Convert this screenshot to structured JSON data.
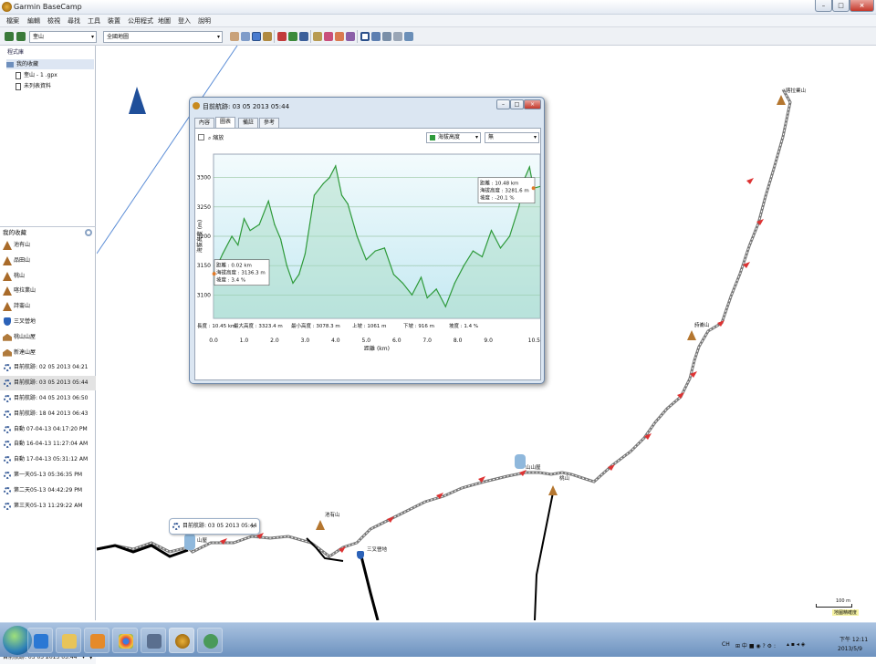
{
  "window": {
    "title": "Garmin BaseCamp"
  },
  "menu": [
    "檔案",
    "編輯",
    "檢視",
    "尋找",
    "工具",
    "裝置",
    "公用程式",
    "地圖",
    "登入",
    "說明"
  ],
  "search": {
    "placeholder": "搜尋"
  },
  "toolbar": {
    "device_dropdown": "奎山",
    "map_dropdown": "全國地圖"
  },
  "library": {
    "header": "程式庫",
    "items": [
      {
        "label": "我的收藏",
        "type": "folder",
        "selected": true
      },
      {
        "label": "奎山 - 1 .gpx",
        "type": "doc"
      },
      {
        "label": "未列表資料",
        "type": "doc"
      }
    ]
  },
  "collection": {
    "header": "我的收藏",
    "items": [
      {
        "label": "池有山",
        "icon": "mountain-icon"
      },
      {
        "label": "品田山",
        "icon": "mountain-icon"
      },
      {
        "label": "桃山",
        "icon": "mountain-icon"
      },
      {
        "label": "喀拉業山",
        "icon": "mountain-icon"
      },
      {
        "label": "詩崙山",
        "icon": "mountain-icon"
      },
      {
        "label": "三叉營地",
        "icon": "flag-icon"
      },
      {
        "label": "桃山山屋",
        "icon": "hut-icon"
      },
      {
        "label": "新達山屋",
        "icon": "hut-icon"
      },
      {
        "label": "目前航跡: 02 05 2013 04:21",
        "icon": "track-icon"
      },
      {
        "label": "目前航跡: 03 05 2013 05:44",
        "icon": "track-icon",
        "selected": true
      },
      {
        "label": "目前航跡: 04 05 2013 06:50",
        "icon": "track-icon"
      },
      {
        "label": "目前航跡: 18 04 2013 06:43",
        "icon": "track-icon"
      },
      {
        "label": "自動 07-04-13 04:17:20 PM",
        "icon": "track-icon"
      },
      {
        "label": "自動 16-04-13 11:27:04 AM",
        "icon": "track-icon"
      },
      {
        "label": "自動 17-04-13 05:31:12 AM",
        "icon": "track-icon"
      },
      {
        "label": "第一天05-13 05:36:35 PM",
        "icon": "track-icon"
      },
      {
        "label": "第二天05-13 04:42:29 PM",
        "icon": "track-icon"
      },
      {
        "label": "第三天05-13 11:29:22 AM",
        "icon": "track-icon"
      }
    ],
    "footer": "目前航跡: 03 05 2013 05:44"
  },
  "map": {
    "labels": {
      "kalaye": "喀拉業山",
      "shilun": "詩崙山",
      "taoshan_hut": "山山屋",
      "taoshan": "桃山",
      "chiyou": "池有山",
      "sancha": "三叉營地",
      "hut2": "山屋"
    },
    "callout": "目前航跡: 03 05 2013 05:44",
    "scale": {
      "label": "100 m",
      "caption": "地圖精確度"
    }
  },
  "profile": {
    "title": "目前航跡: 03 05 2013 05:44",
    "tabs": [
      "內容",
      "圖表",
      "備註",
      "參考"
    ],
    "active_tab": 1,
    "zoom_label": "縮放",
    "legend_label": "海拔高度",
    "right_dropdown": "無",
    "y_axis_label": "海拔高度 (m)",
    "x_axis_label": "距離 (km)",
    "tooltip_start": [
      "距離 : 0.02 km",
      "海拔高度 : 3136.3 m",
      "坡度 : 3.4 %"
    ],
    "tooltip_end": [
      "距離 : 10.48 km",
      "海拔高度 : 3281.6 m",
      "坡度 : -20.1 %"
    ],
    "stats": {
      "length": "長度 : 10.45 km",
      "max": "最大高度 : 3323.4 m",
      "min": "最小高度 : 3078.3 m",
      "ascent": "上坡 : 1061 m",
      "descent": "下坡 : 916 m",
      "grade": "坡度 : 1.4 %"
    }
  },
  "chart_data": {
    "type": "area",
    "title": "",
    "xlabel": "距離 (km)",
    "ylabel": "海拔高度 (m)",
    "xlim": [
      0,
      10.7
    ],
    "ylim": [
      3060,
      3340
    ],
    "x_ticks": [
      "0.0",
      "1.0",
      "2.0",
      "3.0",
      "4.0",
      "5.0",
      "6.0",
      "7.0",
      "8.0",
      "9.0",
      "10.5"
    ],
    "x_tick_values": [
      0,
      1,
      2,
      3,
      4,
      5,
      6,
      7,
      8,
      9,
      10.5
    ],
    "y_ticks": [
      3100,
      3150,
      3200,
      3250,
      3300
    ],
    "series": [
      {
        "name": "海拔高度",
        "color": "#2e9a3a",
        "x": [
          0,
          0.3,
          0.6,
          0.8,
          1.0,
          1.2,
          1.5,
          1.8,
          2.0,
          2.2,
          2.4,
          2.6,
          2.8,
          3.0,
          3.3,
          3.6,
          3.8,
          4.0,
          4.2,
          4.4,
          4.7,
          5.0,
          5.3,
          5.6,
          5.9,
          6.2,
          6.5,
          6.8,
          7.0,
          7.3,
          7.6,
          7.9,
          8.2,
          8.5,
          8.8,
          9.1,
          9.4,
          9.7,
          10.0,
          10.2,
          10.35,
          10.48,
          10.7
        ],
        "values": [
          3136,
          3170,
          3200,
          3185,
          3230,
          3210,
          3220,
          3260,
          3220,
          3195,
          3150,
          3120,
          3135,
          3170,
          3270,
          3290,
          3300,
          3320,
          3270,
          3255,
          3200,
          3160,
          3175,
          3180,
          3135,
          3120,
          3100,
          3130,
          3095,
          3110,
          3080,
          3120,
          3150,
          3175,
          3165,
          3210,
          3180,
          3200,
          3250,
          3300,
          3318,
          3282,
          3285
        ]
      }
    ],
    "legend": "top",
    "grid": true
  }
}
